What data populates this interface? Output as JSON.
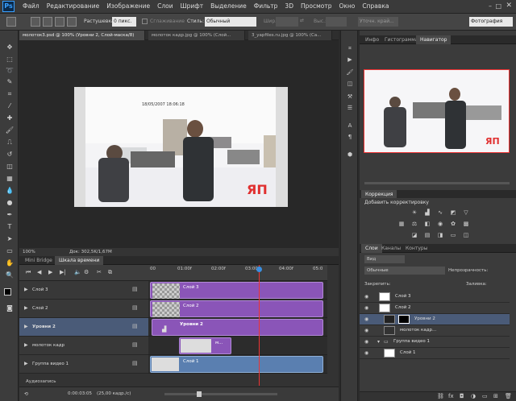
{
  "app": {
    "logo": "Ps"
  },
  "menu": [
    "Файл",
    "Редактирование",
    "Изображение",
    "Слои",
    "Шрифт",
    "Выделение",
    "Фильтр",
    "3D",
    "Просмотр",
    "Окно",
    "Справка"
  ],
  "options": {
    "feather_label": "Растушевка:",
    "feather_value": "0 пикс.",
    "antialias_label": "Сглаживание",
    "style_label": "Стиль:",
    "style_value": "Обычный",
    "width_label": "Шир.:",
    "height_label": "Выс.:",
    "refine_label": "Уточн. край...",
    "workspace_value": "Фотография"
  },
  "doc_tabs": [
    "молоток3.psd @ 100% (Уровни 2, Слой-маска/8)",
    "молоток кадр.jpg @ 100% (Слой...",
    "3_yapfiles.ru.jpg @ 100% (Са..."
  ],
  "canvas_text": {
    "timestamp": "18/05/2007 18:06:18",
    "watermark": "ЯП"
  },
  "status": {
    "zoom": "100%",
    "doc": "Док: 302,5K/1,67M"
  },
  "timeline": {
    "tabs": [
      "Mini Bridge",
      "Шкала времени"
    ],
    "ruler": [
      "00",
      "01:00f",
      "02:00f",
      "03:00f",
      "04:00f",
      "05:0"
    ],
    "tracks": [
      {
        "name": "Слой 3",
        "clip": "Слой 3"
      },
      {
        "name": "Слой 2",
        "clip": "Слой 2"
      },
      {
        "name": "Уровни 2",
        "clip": "Уровни 2"
      },
      {
        "name": "молоток кадр",
        "clip": "м..."
      },
      {
        "name": "Группа видео 1",
        "clip": "Слой 1"
      }
    ],
    "audio": "Аудиозапись",
    "timecode": "0:00:03:05",
    "fps": "(25,00 кадр./с)"
  },
  "right": {
    "top_tabs": [
      "Инфо",
      "Гистограмма",
      "Навигатор"
    ],
    "corr_tab": "Коррекция",
    "corr_add": "Добавить корректировку",
    "layer_tabs": [
      "Слои",
      "Каналы",
      "Контуры"
    ],
    "kind": "Вид",
    "blend": "Обычные",
    "opacity_label": "Непрозрачность:",
    "lock_label": "Закрепить:",
    "fill_label": "Заливка:",
    "layers": [
      "Слой 3",
      "Слой 2",
      "Уровни 2",
      "молоток кадр...",
      "Группа видео 1",
      "Слой 1"
    ]
  }
}
